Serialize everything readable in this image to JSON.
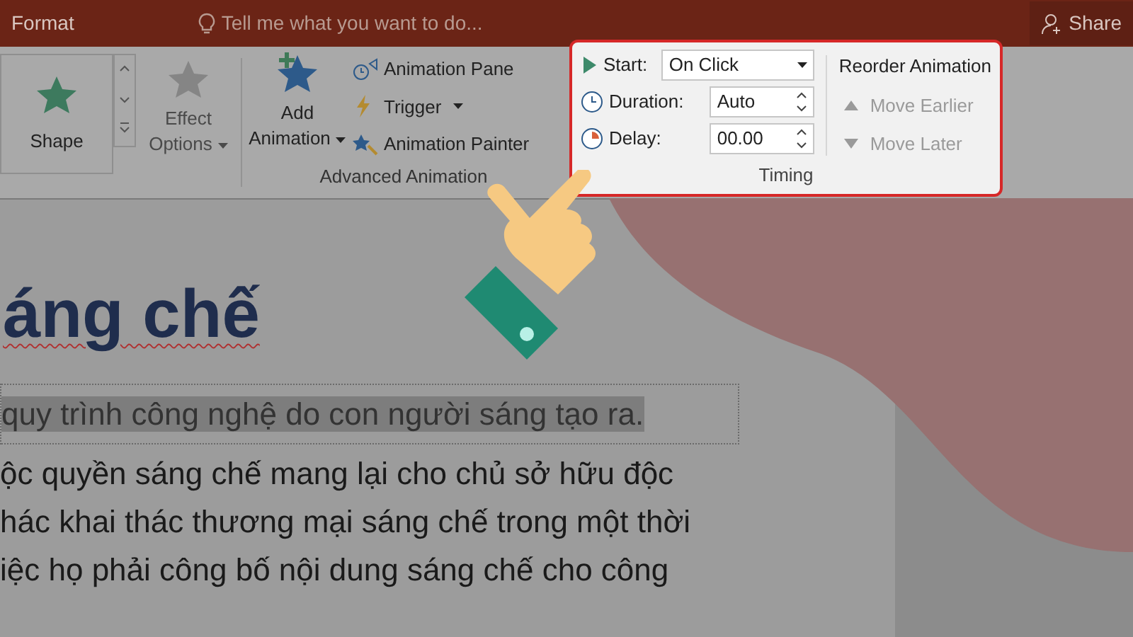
{
  "title_bar": {
    "tab": "Format",
    "tell_me": "Tell me what you want to do...",
    "share": "Share"
  },
  "ribbon": {
    "gallery_item": "Shape",
    "effect_options": {
      "label": "Effect Options",
      "disabled": true
    },
    "advanced": {
      "add_animation": "Add Animation",
      "items": [
        "Animation Pane",
        "Trigger",
        "Animation Painter"
      ],
      "group_label": "Advanced Animation"
    },
    "timing": {
      "start_label": "Start:",
      "start_value": "On Click",
      "duration_label": "Duration:",
      "duration_value": "Auto",
      "delay_label": "Delay:",
      "delay_value": "00.00",
      "reorder_title": "Reorder Animation",
      "reorder_items": [
        {
          "label": "Move Earlier",
          "disabled": true
        },
        {
          "label": "Move Later",
          "disabled": true
        }
      ],
      "group_label": "Timing"
    }
  },
  "slide": {
    "title": "áng chế",
    "selected_line": "quy trình công nghệ do con người sáng tạo ra.",
    "body": [
      "ộc quyền sáng chế mang lại cho chủ sở hữu độc",
      "hác khai thác thương mại sáng chế trong một thời",
      "iệc họ phải công bố nội dung sáng chế cho công"
    ]
  }
}
